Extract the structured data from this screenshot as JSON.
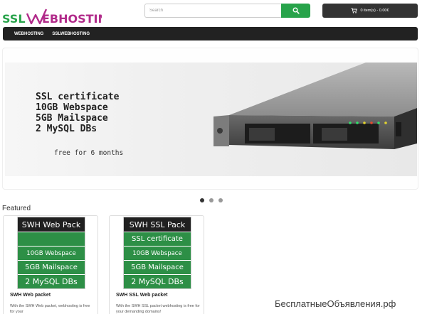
{
  "header": {
    "logo_text": "SSLWEBHOSTING",
    "search": {
      "placeholder": "Search"
    },
    "cart": {
      "label": "0 item(s) - 0.00€"
    },
    "colors": {
      "accent_green": "#27a34a",
      "brand_purple": "#b12a8a",
      "dark": "#222222"
    }
  },
  "nav": {
    "items": [
      {
        "label": "WEBHOSTING"
      },
      {
        "label": "SSLWEBHOSTING"
      }
    ]
  },
  "carousel": {
    "slide_lines": [
      "SSL certificate",
      "10GB Webspace",
      "5GB Mailspace",
      "2 MySQL DBs"
    ],
    "note": "free for 6 months",
    "indicator_count": 3,
    "active_index": 0
  },
  "featured": {
    "heading": "Featured",
    "products": [
      {
        "pack_title": "SWH Web Pack",
        "rows": [
          "",
          "10GB Webspace",
          "5GB Mailspace",
          "2 MySQL DBs"
        ],
        "name": "SWH Web packet",
        "description": "With the SWH Web packet, webhosting is free for your"
      },
      {
        "pack_title": "SWH SSL Pack",
        "rows": [
          "SSL certificate",
          "10GB Webspace",
          "5GB Mailspace",
          "2 MySQL DBs"
        ],
        "name": "SWH SSL Web packet",
        "description": "With the SWH SSL packet webhosting is free for your demanding domains!"
      }
    ]
  },
  "watermark": "БесплатныеОбъявления.рф"
}
